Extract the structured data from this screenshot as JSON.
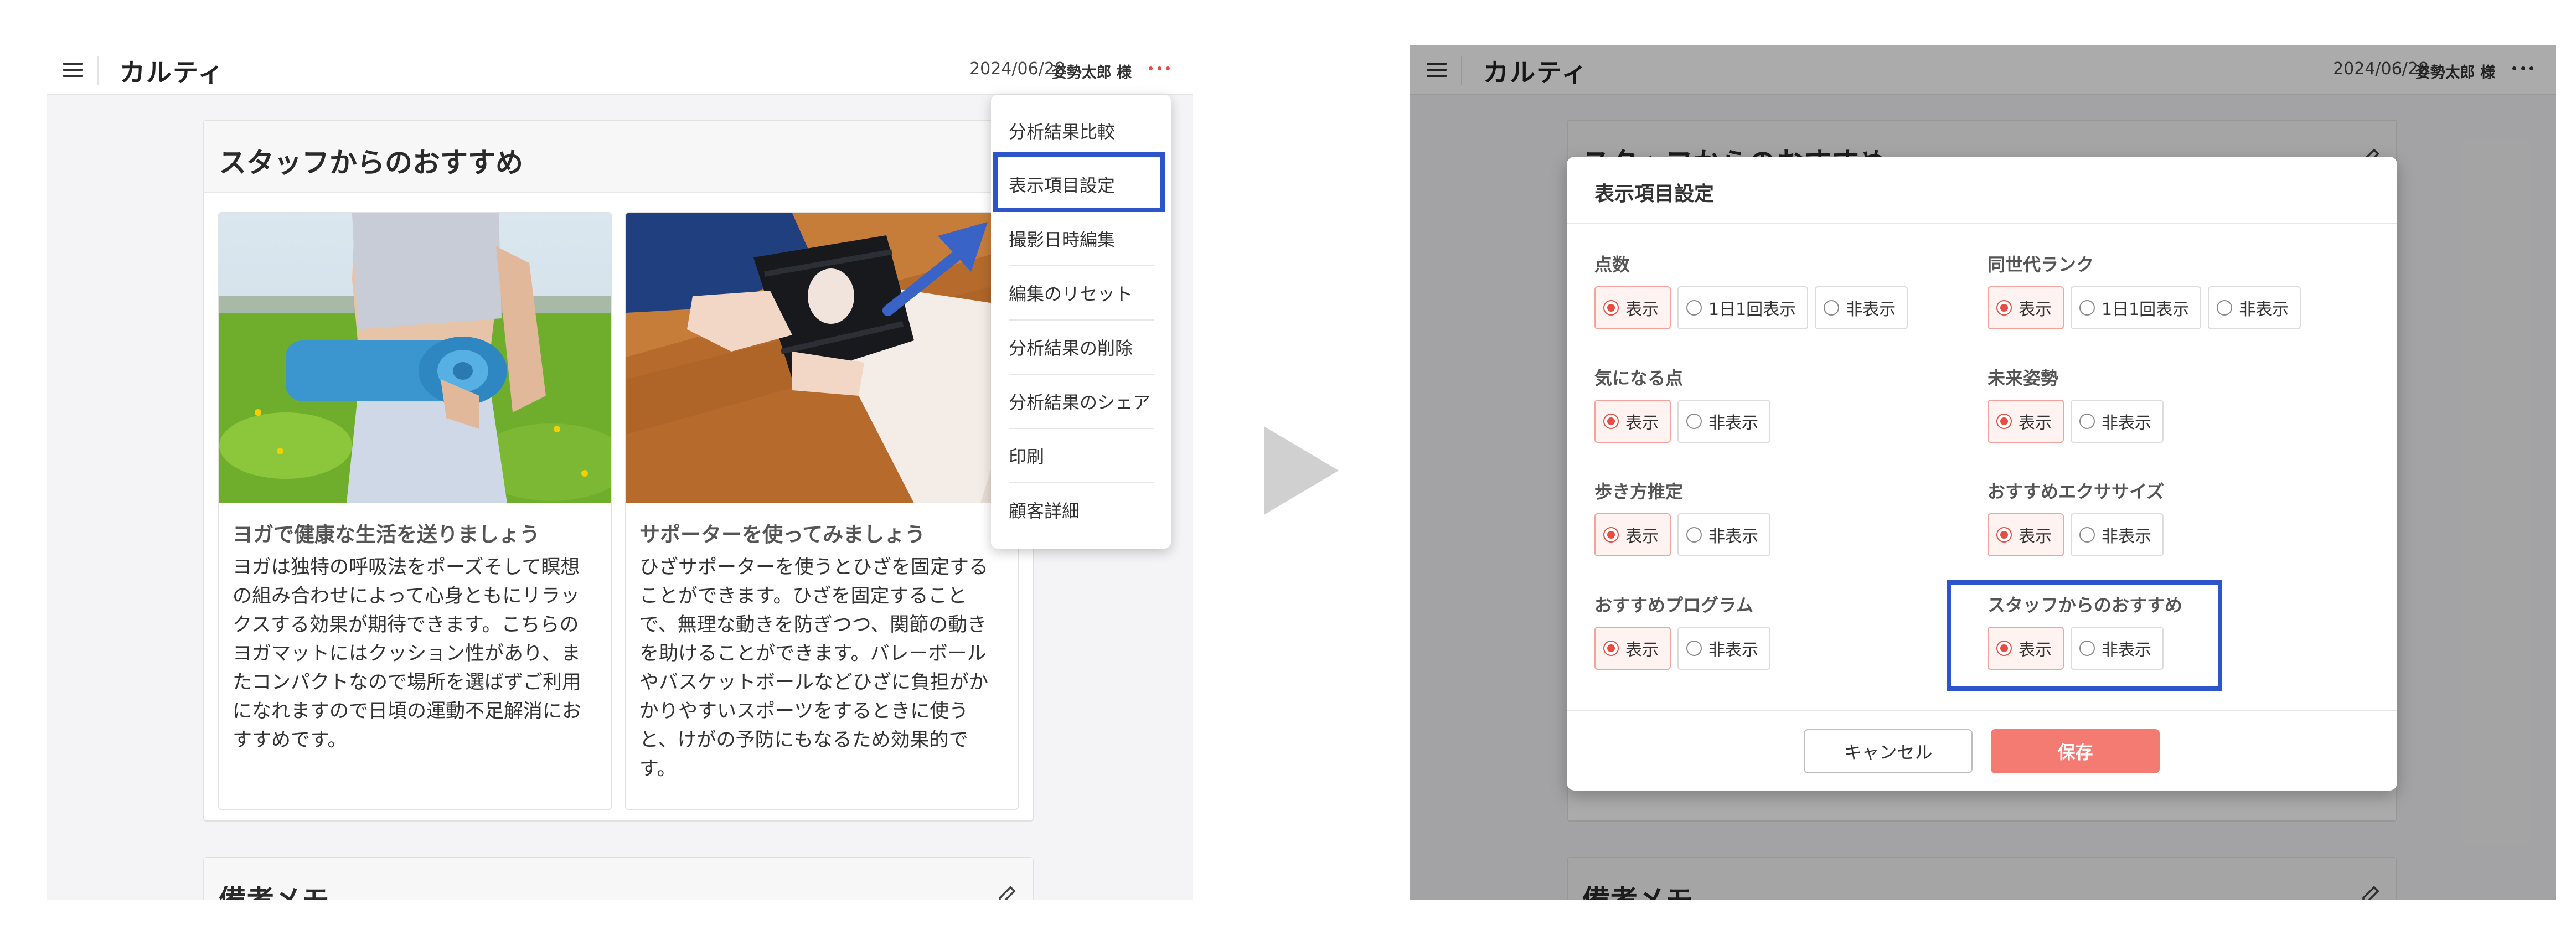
{
  "app": {
    "title": "カルティ",
    "date": "2024/06/28",
    "user": "姿勢太郎 様",
    "accent_color": "#e94c45",
    "highlight_color": "#2b55c9"
  },
  "left": {
    "section_title": "スタッフからのおすすめ",
    "cards": [
      {
        "title": "ヨガで健康な生活を送りましょう",
        "lines": [
          "ヨガは独特の呼吸法をポーズそして瞑想",
          "の組み合わせによって心身ともにリラッ",
          "クスする効果が期待できます。こちらの",
          "ヨガマットにはクッション性があり、ま",
          "たコンパクトなので場所を選ばずご利用",
          "になれますので日頃の運動不足解消にお",
          "すすめです。"
        ]
      },
      {
        "title": "サポーターを使ってみましょう",
        "lines": [
          "ひざサポーターを使うとひざを固定する",
          "ことができます。ひざを固定すること",
          "で、無理な動きを防ぎつつ、関節の動き",
          "を助けることができます。バレーボール",
          "やバスケットボールなどひざに負担がか",
          "かりやすいスポーツをするときに使う",
          "と、けがの予防にもなるため効果的で",
          "す。"
        ]
      }
    ],
    "memo_title": "備考メモ",
    "menu_items": [
      "分析結果比較",
      "表示項目設定",
      "撮影日時編集",
      "編集のリセット",
      "分析結果の削除",
      "分析結果のシェア",
      "印刷",
      "顧客詳細"
    ],
    "highlighted_menu_item": "表示項目設定"
  },
  "modal": {
    "title": "表示項目設定",
    "settings": [
      {
        "label": "点数",
        "options": [
          "表示",
          "1日1回表示",
          "非表示"
        ],
        "selected": "表示"
      },
      {
        "label": "同世代ランク",
        "options": [
          "表示",
          "1日1回表示",
          "非表示"
        ],
        "selected": "表示"
      },
      {
        "label": "気になる点",
        "options": [
          "表示",
          "非表示"
        ],
        "selected": "表示"
      },
      {
        "label": "未来姿勢",
        "options": [
          "表示",
          "非表示"
        ],
        "selected": "表示"
      },
      {
        "label": "歩き方推定",
        "options": [
          "表示",
          "非表示"
        ],
        "selected": "表示"
      },
      {
        "label": "おすすめエクササイズ",
        "options": [
          "表示",
          "非表示"
        ],
        "selected": "表示"
      },
      {
        "label": "おすすめプログラム",
        "options": [
          "表示",
          "非表示"
        ],
        "selected": "表示"
      },
      {
        "label": "スタッフからのおすすめ",
        "options": [
          "表示",
          "非表示"
        ],
        "selected": "表示"
      }
    ],
    "cancel_label": "キャンセル",
    "save_label": "保存",
    "save_color": "#f47b72"
  },
  "icons": [
    "menu-icon",
    "more-icon",
    "edit-icon",
    "next-arrow-icon"
  ]
}
